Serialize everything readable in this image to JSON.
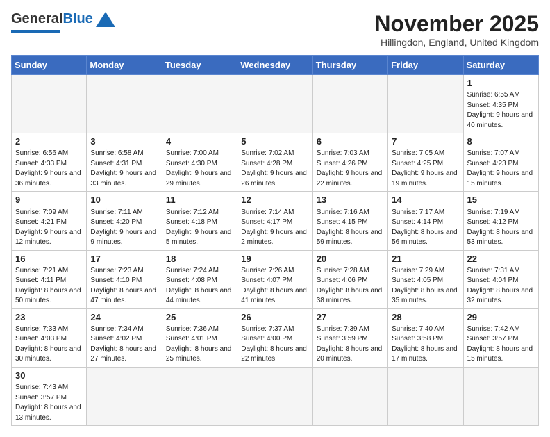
{
  "header": {
    "logo_general": "General",
    "logo_blue": "Blue",
    "title": "November 2025",
    "subtitle": "Hillingdon, England, United Kingdom"
  },
  "weekdays": [
    "Sunday",
    "Monday",
    "Tuesday",
    "Wednesday",
    "Thursday",
    "Friday",
    "Saturday"
  ],
  "weeks": [
    [
      {
        "day": "",
        "info": ""
      },
      {
        "day": "",
        "info": ""
      },
      {
        "day": "",
        "info": ""
      },
      {
        "day": "",
        "info": ""
      },
      {
        "day": "",
        "info": ""
      },
      {
        "day": "",
        "info": ""
      },
      {
        "day": "1",
        "info": "Sunrise: 6:55 AM\nSunset: 4:35 PM\nDaylight: 9 hours and 40 minutes."
      }
    ],
    [
      {
        "day": "2",
        "info": "Sunrise: 6:56 AM\nSunset: 4:33 PM\nDaylight: 9 hours and 36 minutes."
      },
      {
        "day": "3",
        "info": "Sunrise: 6:58 AM\nSunset: 4:31 PM\nDaylight: 9 hours and 33 minutes."
      },
      {
        "day": "4",
        "info": "Sunrise: 7:00 AM\nSunset: 4:30 PM\nDaylight: 9 hours and 29 minutes."
      },
      {
        "day": "5",
        "info": "Sunrise: 7:02 AM\nSunset: 4:28 PM\nDaylight: 9 hours and 26 minutes."
      },
      {
        "day": "6",
        "info": "Sunrise: 7:03 AM\nSunset: 4:26 PM\nDaylight: 9 hours and 22 minutes."
      },
      {
        "day": "7",
        "info": "Sunrise: 7:05 AM\nSunset: 4:25 PM\nDaylight: 9 hours and 19 minutes."
      },
      {
        "day": "8",
        "info": "Sunrise: 7:07 AM\nSunset: 4:23 PM\nDaylight: 9 hours and 15 minutes."
      }
    ],
    [
      {
        "day": "9",
        "info": "Sunrise: 7:09 AM\nSunset: 4:21 PM\nDaylight: 9 hours and 12 minutes."
      },
      {
        "day": "10",
        "info": "Sunrise: 7:11 AM\nSunset: 4:20 PM\nDaylight: 9 hours and 9 minutes."
      },
      {
        "day": "11",
        "info": "Sunrise: 7:12 AM\nSunset: 4:18 PM\nDaylight: 9 hours and 5 minutes."
      },
      {
        "day": "12",
        "info": "Sunrise: 7:14 AM\nSunset: 4:17 PM\nDaylight: 9 hours and 2 minutes."
      },
      {
        "day": "13",
        "info": "Sunrise: 7:16 AM\nSunset: 4:15 PM\nDaylight: 8 hours and 59 minutes."
      },
      {
        "day": "14",
        "info": "Sunrise: 7:17 AM\nSunset: 4:14 PM\nDaylight: 8 hours and 56 minutes."
      },
      {
        "day": "15",
        "info": "Sunrise: 7:19 AM\nSunset: 4:12 PM\nDaylight: 8 hours and 53 minutes."
      }
    ],
    [
      {
        "day": "16",
        "info": "Sunrise: 7:21 AM\nSunset: 4:11 PM\nDaylight: 8 hours and 50 minutes."
      },
      {
        "day": "17",
        "info": "Sunrise: 7:23 AM\nSunset: 4:10 PM\nDaylight: 8 hours and 47 minutes."
      },
      {
        "day": "18",
        "info": "Sunrise: 7:24 AM\nSunset: 4:08 PM\nDaylight: 8 hours and 44 minutes."
      },
      {
        "day": "19",
        "info": "Sunrise: 7:26 AM\nSunset: 4:07 PM\nDaylight: 8 hours and 41 minutes."
      },
      {
        "day": "20",
        "info": "Sunrise: 7:28 AM\nSunset: 4:06 PM\nDaylight: 8 hours and 38 minutes."
      },
      {
        "day": "21",
        "info": "Sunrise: 7:29 AM\nSunset: 4:05 PM\nDaylight: 8 hours and 35 minutes."
      },
      {
        "day": "22",
        "info": "Sunrise: 7:31 AM\nSunset: 4:04 PM\nDaylight: 8 hours and 32 minutes."
      }
    ],
    [
      {
        "day": "23",
        "info": "Sunrise: 7:33 AM\nSunset: 4:03 PM\nDaylight: 8 hours and 30 minutes."
      },
      {
        "day": "24",
        "info": "Sunrise: 7:34 AM\nSunset: 4:02 PM\nDaylight: 8 hours and 27 minutes."
      },
      {
        "day": "25",
        "info": "Sunrise: 7:36 AM\nSunset: 4:01 PM\nDaylight: 8 hours and 25 minutes."
      },
      {
        "day": "26",
        "info": "Sunrise: 7:37 AM\nSunset: 4:00 PM\nDaylight: 8 hours and 22 minutes."
      },
      {
        "day": "27",
        "info": "Sunrise: 7:39 AM\nSunset: 3:59 PM\nDaylight: 8 hours and 20 minutes."
      },
      {
        "day": "28",
        "info": "Sunrise: 7:40 AM\nSunset: 3:58 PM\nDaylight: 8 hours and 17 minutes."
      },
      {
        "day": "29",
        "info": "Sunrise: 7:42 AM\nSunset: 3:57 PM\nDaylight: 8 hours and 15 minutes."
      }
    ],
    [
      {
        "day": "30",
        "info": "Sunrise: 7:43 AM\nSunset: 3:57 PM\nDaylight: 8 hours and 13 minutes."
      },
      {
        "day": "",
        "info": ""
      },
      {
        "day": "",
        "info": ""
      },
      {
        "day": "",
        "info": ""
      },
      {
        "day": "",
        "info": ""
      },
      {
        "day": "",
        "info": ""
      },
      {
        "day": "",
        "info": ""
      }
    ]
  ]
}
